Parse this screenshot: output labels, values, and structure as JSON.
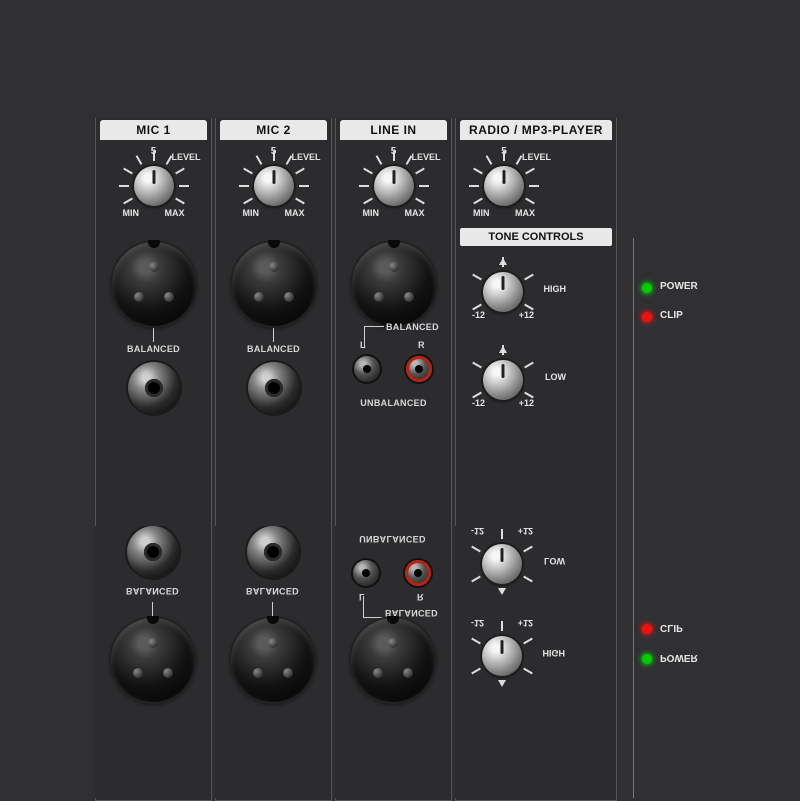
{
  "channels": {
    "mic1": {
      "title": "MIC 1",
      "level_top": "5",
      "level_right": "LEVEL",
      "level_min": "MIN",
      "level_max": "MAX",
      "balanced": "BALANCED"
    },
    "mic2": {
      "title": "MIC 2",
      "level_top": "5",
      "level_right": "LEVEL",
      "level_min": "MIN",
      "level_max": "MAX",
      "balanced": "BALANCED"
    },
    "line": {
      "title": "LINE IN",
      "level_top": "5",
      "level_right": "LEVEL",
      "level_min": "MIN",
      "level_max": "MAX",
      "balanced": "BALANCED",
      "l": "L",
      "r": "R",
      "unbalanced": "UNBALANCED"
    },
    "radio": {
      "title": "RADIO / MP3-PLAYER",
      "level_top": "5",
      "level_right": "LEVEL",
      "level_min": "MIN",
      "level_max": "MAX",
      "tone_header": "TONE CONTROLS",
      "high": {
        "side": "HIGH",
        "minus": "-12",
        "plus": "+12"
      },
      "low": {
        "side": "LOW",
        "minus": "-12",
        "plus": "+12"
      }
    }
  },
  "status": {
    "power": "POWER",
    "clip": "CLIP"
  },
  "mirror": {
    "line": {
      "unbalanced": "UNBALANCED",
      "l": "L",
      "r": "R",
      "balanced": "BALANCED"
    },
    "radio": {
      "low": {
        "side": "LOW",
        "minus": "-12",
        "plus": "+12"
      },
      "high": {
        "side": "HIGH",
        "minus": "-12",
        "plus": "+12"
      }
    },
    "status": {
      "power": "POWER",
      "clip": "CLIP"
    },
    "mic": {
      "balanced": "BALANCED"
    }
  }
}
